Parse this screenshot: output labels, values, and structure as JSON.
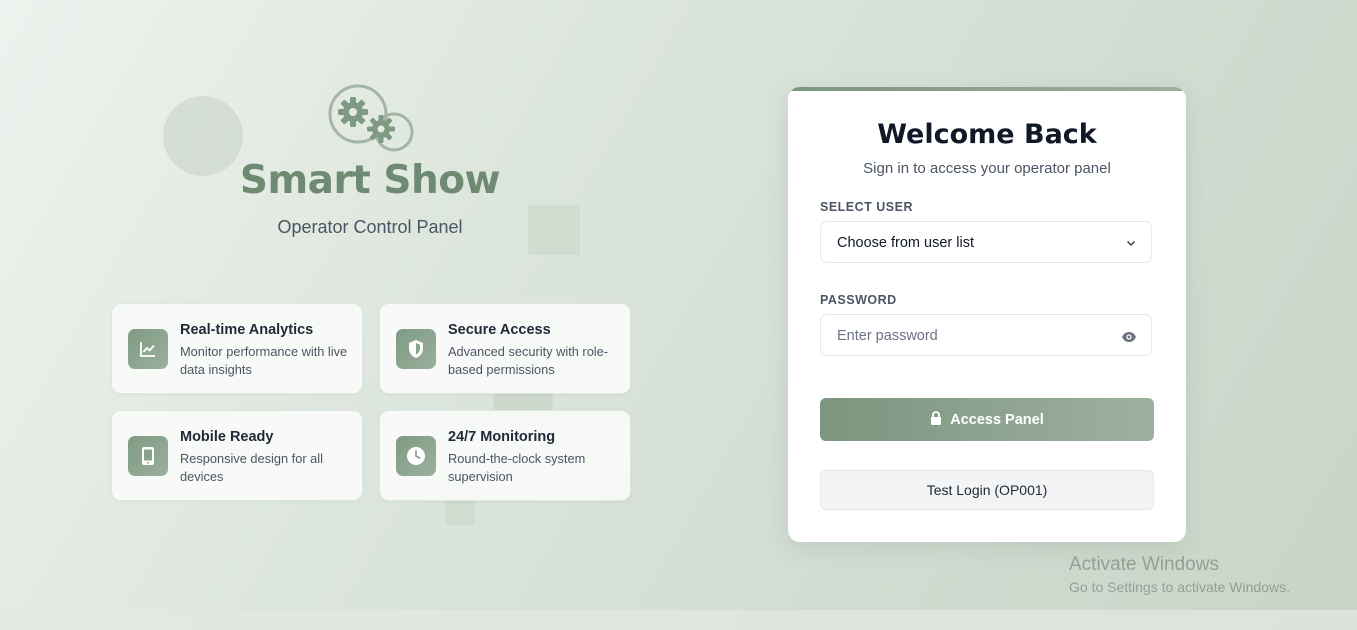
{
  "brand": {
    "title": "Smart Show",
    "subtitle": "Operator Control Panel"
  },
  "features": [
    {
      "title": "Real-time Analytics",
      "description": "Monitor performance with live data insights",
      "icon": "chart-icon"
    },
    {
      "title": "Secure Access",
      "description": "Advanced security with role-based permissions",
      "icon": "shield-icon"
    },
    {
      "title": "Mobile Ready",
      "description": "Responsive design for all devices",
      "icon": "mobile-icon"
    },
    {
      "title": "24/7 Monitoring",
      "description": "Round-the-clock system supervision",
      "icon": "clock-icon"
    }
  ],
  "login": {
    "title": "Welcome Back",
    "subtitle": "Sign in to access your operator panel",
    "select_label": "SELECT USER",
    "select_value": "Choose from user list",
    "password_label": "PASSWORD",
    "password_placeholder": "Enter password",
    "submit_label": "Access Panel",
    "test_login_label": "Test Login (OP001)"
  },
  "watermark": {
    "title": "Activate Windows",
    "subtitle": "Go to Settings to activate Windows."
  },
  "colors": {
    "accent": "#7c957f",
    "brand_title": "#6f8a72"
  }
}
